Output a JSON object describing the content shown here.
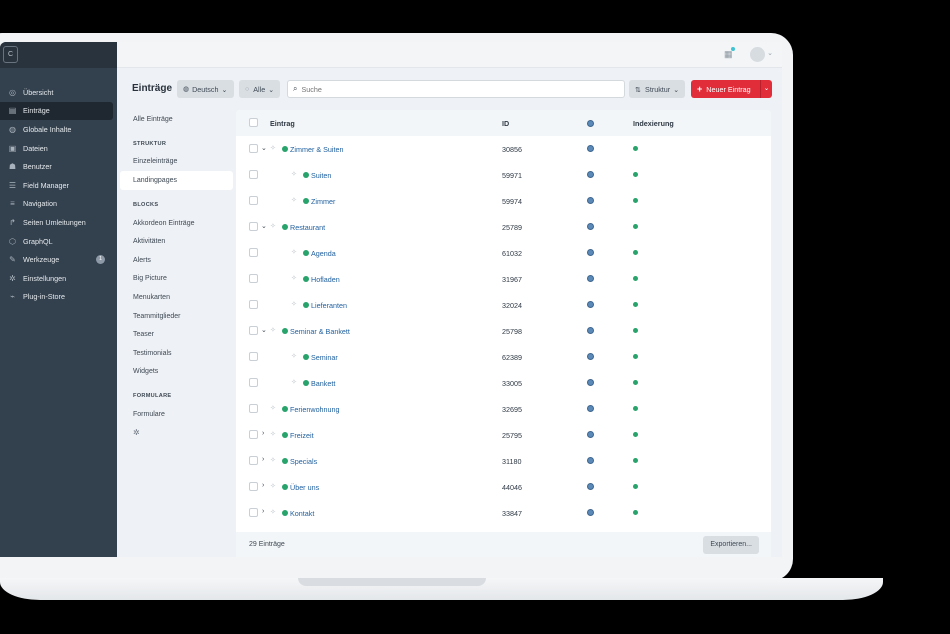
{
  "sidebar": {
    "logo": "C",
    "items": [
      {
        "label": "Übersicht",
        "icon": "dashboard-icon",
        "glyph": "◎"
      },
      {
        "label": "Einträge",
        "icon": "entries-icon",
        "glyph": "▤",
        "active": true
      },
      {
        "label": "Globale Inhalte",
        "icon": "globe-icon",
        "glyph": "◍"
      },
      {
        "label": "Dateien",
        "icon": "image-icon",
        "glyph": "▣"
      },
      {
        "label": "Benutzer",
        "icon": "users-icon",
        "glyph": "☗"
      },
      {
        "label": "Field Manager",
        "icon": "field-icon",
        "glyph": "☰"
      },
      {
        "label": "Navigation",
        "icon": "menu-icon",
        "glyph": "≡"
      },
      {
        "label": "Seiten Umleitungen",
        "icon": "redirect-icon",
        "glyph": "↱"
      },
      {
        "label": "GraphQL",
        "icon": "graphql-icon",
        "glyph": "⬡"
      },
      {
        "label": "Werkzeuge",
        "icon": "wrench-icon",
        "glyph": "✎",
        "badge": "1"
      },
      {
        "label": "Einstellungen",
        "icon": "gear-icon",
        "glyph": "✲"
      },
      {
        "label": "Plug-in-Store",
        "icon": "plug-icon",
        "glyph": "⌁"
      }
    ]
  },
  "toolbar": {
    "title": "Einträge",
    "language": "Deutsch",
    "status": "Alle",
    "search_placeholder": "Suche",
    "structure": "Struktur",
    "new_entry": "Neuer Eintrag"
  },
  "sources": {
    "all": "Alle Einträge",
    "sections": [
      {
        "heading": "STRUKTUR",
        "items": [
          "Einzeleinträge",
          "Landingpages"
        ]
      },
      {
        "heading": "BLOCKS",
        "items": [
          "Akkordeon Einträge",
          "Aktivitäten",
          "Alerts",
          "Big Picture",
          "Menukarten",
          "Teammitglieder",
          "Teaser",
          "Testimonials",
          "Widgets"
        ]
      },
      {
        "heading": "FORMULARE",
        "items": [
          "Formulare"
        ]
      }
    ],
    "selected": "Landingpages"
  },
  "table": {
    "columns": {
      "entry": "Eintrag",
      "id": "ID",
      "index": "Indexierung"
    },
    "rows": [
      {
        "title": "Zimmer & Suiten",
        "id": "30856",
        "level": 0,
        "toggle": "expanded"
      },
      {
        "title": "Suiten",
        "id": "59971",
        "level": 1,
        "toggle": "none"
      },
      {
        "title": "Zimmer",
        "id": "59974",
        "level": 1,
        "toggle": "none"
      },
      {
        "title": "Restaurant",
        "id": "25789",
        "level": 0,
        "toggle": "expanded"
      },
      {
        "title": "Agenda",
        "id": "61032",
        "level": 1,
        "toggle": "none"
      },
      {
        "title": "Hofladen",
        "id": "31967",
        "level": 1,
        "toggle": "none"
      },
      {
        "title": "Lieferanten",
        "id": "32024",
        "level": 1,
        "toggle": "none"
      },
      {
        "title": "Seminar & Bankett",
        "id": "25798",
        "level": 0,
        "toggle": "expanded"
      },
      {
        "title": "Seminar",
        "id": "62389",
        "level": 1,
        "toggle": "none"
      },
      {
        "title": "Bankett",
        "id": "33005",
        "level": 1,
        "toggle": "none"
      },
      {
        "title": "Ferienwohnung",
        "id": "32695",
        "level": 0,
        "toggle": "none"
      },
      {
        "title": "Freizeit",
        "id": "25795",
        "level": 0,
        "toggle": "collapsed"
      },
      {
        "title": "Specials",
        "id": "31180",
        "level": 0,
        "toggle": "collapsed"
      },
      {
        "title": "Über uns",
        "id": "44046",
        "level": 0,
        "toggle": "collapsed"
      },
      {
        "title": "Kontakt",
        "id": "33847",
        "level": 0,
        "toggle": "collapsed"
      }
    ]
  },
  "footer": {
    "count": "29 Einträge",
    "export": "Exportieren..."
  },
  "colors": {
    "sidebar": "#33404d",
    "accent_red": "#e12d39",
    "status_green": "#27a36b",
    "link_blue": "#1f5f9e"
  }
}
